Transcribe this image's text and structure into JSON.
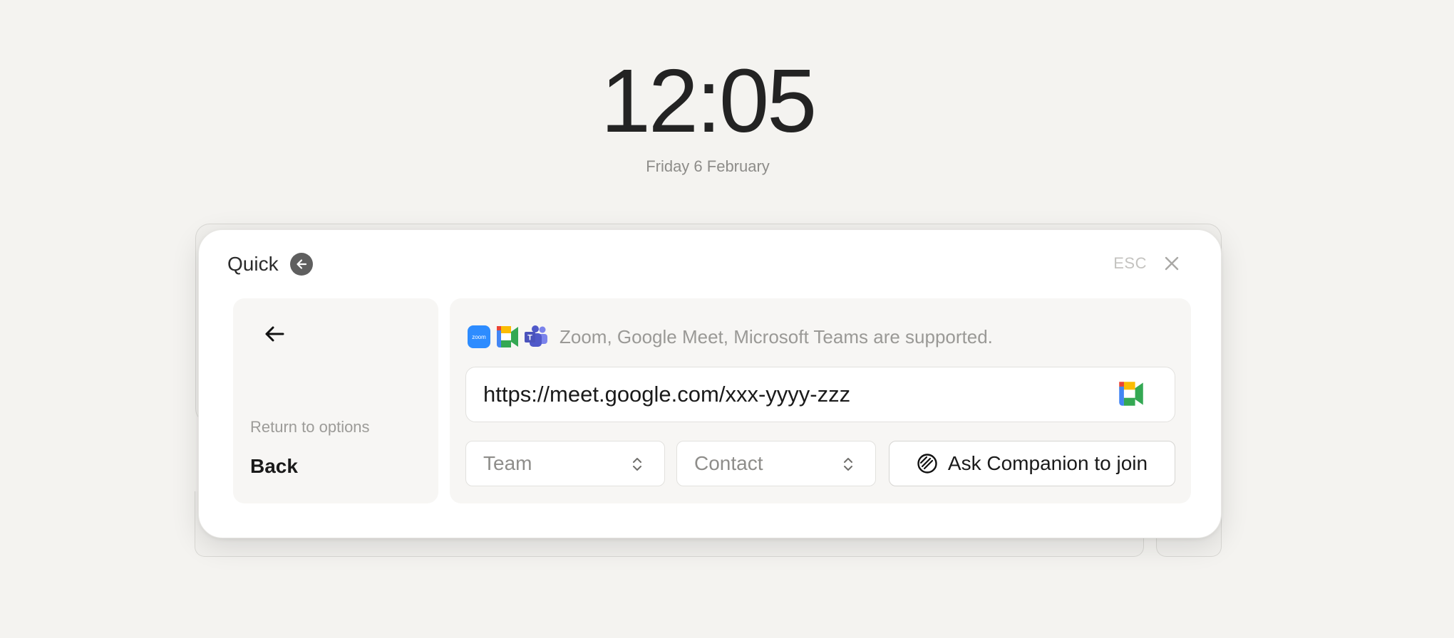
{
  "clock": {
    "time": "12:05",
    "date": "Friday 6 February"
  },
  "modal": {
    "title": "Quick",
    "esc_label": "ESC",
    "left_panel": {
      "return_label": "Return to options",
      "back_label": "Back"
    },
    "supported": {
      "icons": [
        "zoom-icon",
        "google-meet-icon",
        "microsoft-teams-icon"
      ],
      "zoom_icon_text": "zoom",
      "teams_icon_text": "T",
      "text": "Zoom, Google Meet, Microsoft Teams are supported."
    },
    "url_input": {
      "value": "https://meet.google.com/xxx-yyyy-zzz",
      "detected_icon": "google-meet-icon"
    },
    "team_select": {
      "value": "Team"
    },
    "contact_select": {
      "value": "Contact"
    },
    "ask_button": {
      "label": "Ask Companion to join",
      "icon": "companion-icon"
    }
  },
  "colors": {
    "background": "#f4f3f0",
    "zoom_blue": "#2d8cff",
    "meet_green": "#34a853",
    "meet_yellow": "#fbbc04",
    "meet_red": "#ea4335",
    "meet_blue": "#4285f4",
    "teams_purple": "#5059c9"
  }
}
